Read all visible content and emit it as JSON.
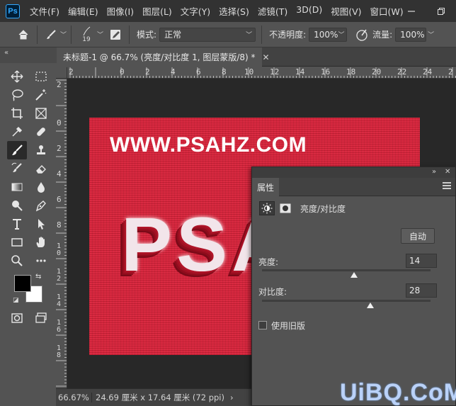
{
  "app": {
    "logo": "Ps"
  },
  "menu": [
    "文件(F)",
    "编辑(E)",
    "图像(I)",
    "图层(L)",
    "文字(Y)",
    "选择(S)",
    "滤镜(T)",
    "3D(D)",
    "视图(V)",
    "窗口(W)"
  ],
  "options": {
    "brush_size": "19",
    "mode_label": "模式:",
    "mode_value": "正常",
    "opacity_label": "不透明度:",
    "opacity_value": "100%",
    "flow_label": "流量:",
    "flow_value": "100%"
  },
  "document": {
    "tab_title": "未标题-1 @ 66.7% (亮度/对比度 1, 图层蒙版/8) *"
  },
  "rulers": {
    "h": [
      "2",
      "0",
      "2",
      "4",
      "6",
      "8",
      "10",
      "12",
      "14",
      "16",
      "18",
      "20",
      "22",
      "24",
      "2"
    ],
    "v": [
      "2",
      "0",
      "2",
      "4",
      "6",
      "8",
      "1 0",
      "1 2",
      "1 4",
      "1 6",
      "1 8"
    ]
  },
  "canvas": {
    "site_text": "WWW.PSAHZ.COM",
    "big_text": "PSAHZ",
    "background_color": "#d9223a"
  },
  "status": {
    "zoom": "66.67%",
    "doc_info": "24.69 厘米 x 17.64 厘米 (72 ppi)",
    "arrow": "›"
  },
  "properties": {
    "tab": "属性",
    "adjustment_title": "亮度/对比度",
    "auto_label": "自动",
    "brightness_label": "亮度:",
    "brightness_value": 14,
    "contrast_label": "对比度:",
    "contrast_value": 28,
    "legacy_label": "使用旧版"
  },
  "watermark": "UiBQ.CoM",
  "icons": [
    "home-icon",
    "brush-icon",
    "brush-settings-icon",
    "airbrush-icon",
    "pressure-icon",
    "close-icon",
    "minimize-icon",
    "restore-icon"
  ]
}
